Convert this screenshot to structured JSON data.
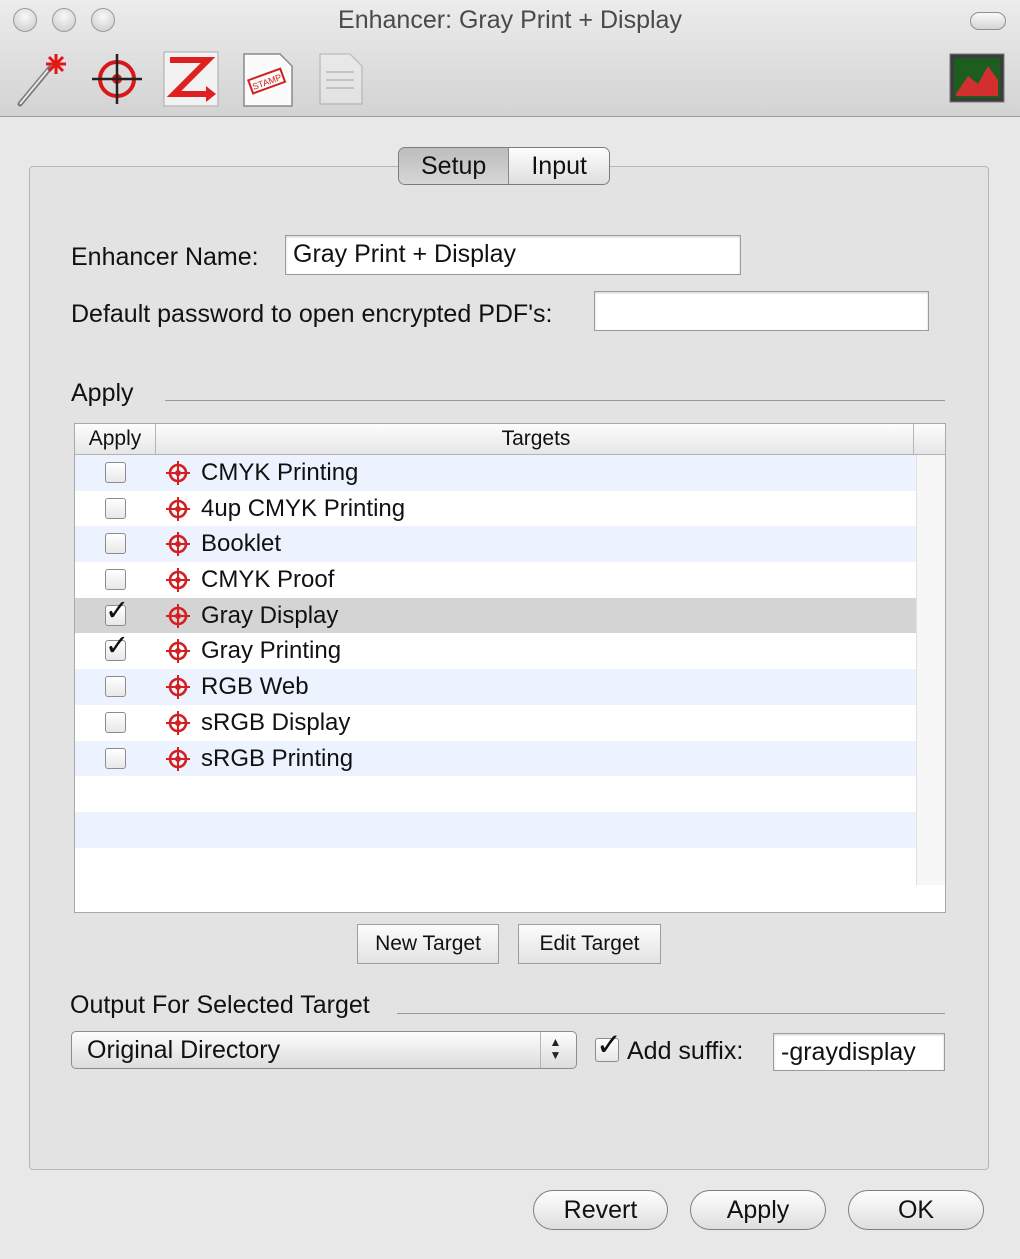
{
  "window": {
    "title": "Enhancer: Gray Print + Display"
  },
  "toolbar": {
    "icons": [
      "magic-wand-icon",
      "target-icon",
      "convert-icon",
      "stamp-icon",
      "document-icon",
      "preview-icon"
    ]
  },
  "tabs": [
    {
      "label": "Setup",
      "active": true
    },
    {
      "label": "Input",
      "active": false
    }
  ],
  "form": {
    "name_label": "Enhancer Name:",
    "name_value": "Gray Print + Display",
    "password_label": "Default password to open encrypted PDF's:",
    "password_value": ""
  },
  "apply_section": {
    "heading": "Apply",
    "columns": [
      "Apply",
      "Targets"
    ],
    "rows": [
      {
        "checked": false,
        "name": "CMYK Printing"
      },
      {
        "checked": false,
        "name": "4up CMYK Printing"
      },
      {
        "checked": false,
        "name": "Booklet"
      },
      {
        "checked": false,
        "name": "CMYK Proof"
      },
      {
        "checked": true,
        "name": "Gray Display",
        "selected": true
      },
      {
        "checked": true,
        "name": "Gray Printing"
      },
      {
        "checked": false,
        "name": "RGB Web"
      },
      {
        "checked": false,
        "name": "sRGB Display"
      },
      {
        "checked": false,
        "name": "sRGB Printing"
      }
    ],
    "new_target_label": "New Target",
    "edit_target_label": "Edit Target"
  },
  "output": {
    "heading": "Output For Selected Target",
    "destination": "Original Directory",
    "add_suffix_checked": true,
    "add_suffix_label": "Add suffix:",
    "suffix_value": "-graydisplay"
  },
  "buttons": {
    "revert": "Revert",
    "apply": "Apply",
    "ok": "OK"
  },
  "colors": {
    "target_icon": "#d42020",
    "row_alt": "#edf3fe",
    "row_selected": "#d4d4d4"
  }
}
